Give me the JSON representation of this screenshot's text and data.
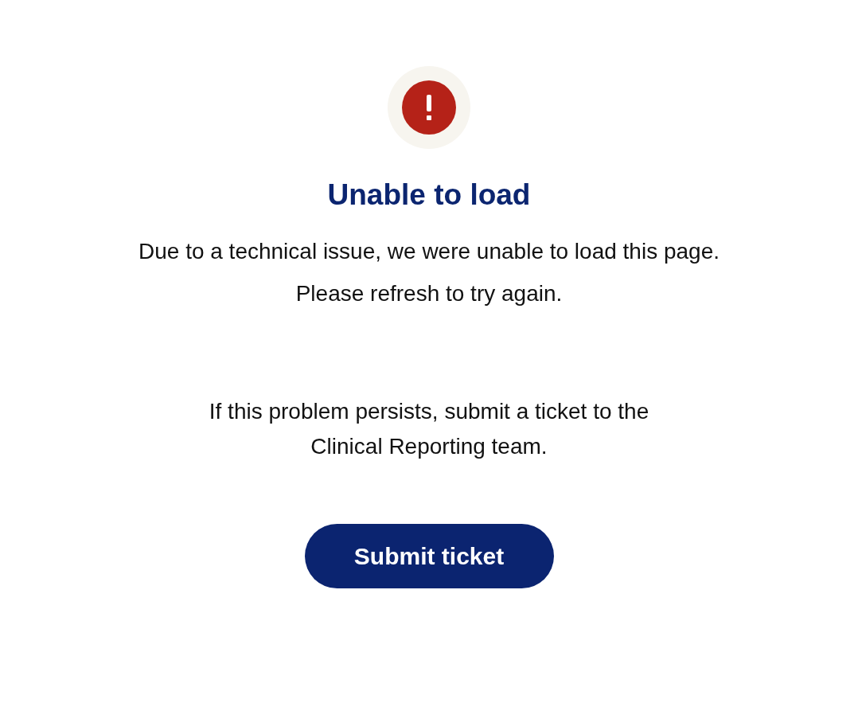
{
  "status": {
    "kind": "error"
  },
  "title": "Unable to load",
  "message": {
    "lines": [
      "Due to a technical issue, we were unable to load this page.",
      "Please refresh to try again."
    ]
  },
  "help": {
    "lines": [
      "If this problem persists, submit a ticket to the",
      "Clinical Reporting team."
    ]
  },
  "button": {
    "label": "Submit ticket"
  }
}
